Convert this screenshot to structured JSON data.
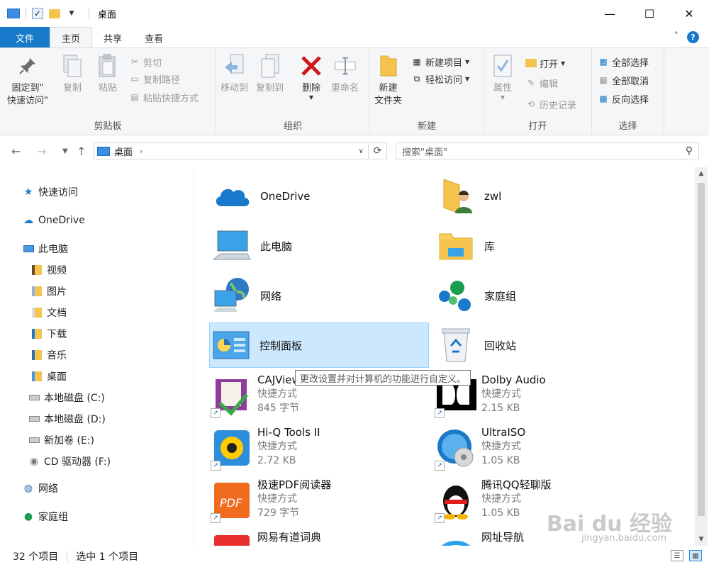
{
  "window": {
    "title": "桌面"
  },
  "ribbon_tabs": {
    "file": "文件",
    "home": "主页",
    "share": "共享",
    "view": "查看"
  },
  "ribbon": {
    "clipboard": {
      "label": "剪贴板",
      "pin_l1": "固定到\"",
      "pin_l2": "快速访问\"",
      "copy": "复制",
      "paste": "粘贴",
      "cut": "剪切",
      "copy_path": "复制路径",
      "paste_shortcut": "粘贴快捷方式"
    },
    "organize": {
      "label": "组织",
      "move_to": "移动到",
      "copy_to": "复制到",
      "delete": "删除",
      "rename": "重命名"
    },
    "new": {
      "label": "新建",
      "new_folder_l1": "新建",
      "new_folder_l2": "文件夹",
      "new_item": "新建项目",
      "easy_access": "轻松访问"
    },
    "open": {
      "label": "打开",
      "properties": "属性",
      "open": "打开",
      "edit": "编辑",
      "history": "历史记录"
    },
    "select": {
      "label": "选择",
      "select_all": "全部选择",
      "select_none": "全部取消",
      "invert": "反向选择"
    }
  },
  "address": {
    "path": "桌面",
    "search_placeholder": "搜索\"桌面\""
  },
  "sidebar": {
    "items": [
      {
        "label": "快速访问"
      },
      {
        "label": "OneDrive"
      },
      {
        "label": "此电脑"
      },
      {
        "label": "视频"
      },
      {
        "label": "图片"
      },
      {
        "label": "文档"
      },
      {
        "label": "下载"
      },
      {
        "label": "音乐"
      },
      {
        "label": "桌面"
      },
      {
        "label": "本地磁盘 (C:)"
      },
      {
        "label": "本地磁盘 (D:)"
      },
      {
        "label": "新加卷 (E:)"
      },
      {
        "label": "CD 驱动器 (F:)"
      },
      {
        "label": "网络"
      },
      {
        "label": "家庭组"
      }
    ]
  },
  "files": {
    "onedrive": "OneDrive",
    "zwl": "zwl",
    "this_pc": "此电脑",
    "library": "库",
    "network": "网络",
    "homegroup": "家庭组",
    "control_panel": "控制面板",
    "recycle_bin": "回收站",
    "cajviewer": {
      "name": "CAJViewer 7.2",
      "type": "快捷方式",
      "size": "845 字节"
    },
    "dolby": {
      "name": "Dolby Audio",
      "type": "快捷方式",
      "size": "2.15 KB"
    },
    "hiq": {
      "name": "Hi-Q Tools II",
      "type": "快捷方式",
      "size": "2.72 KB"
    },
    "ultraiso": {
      "name": "UltraISO",
      "type": "快捷方式",
      "size": "1.05 KB"
    },
    "pdf": {
      "name": "极速PDF阅读器",
      "type": "快捷方式",
      "size": "729 字节"
    },
    "qq": {
      "name": "腾讯QQ轻聊版",
      "type": "快捷方式",
      "size": "1.05 KB"
    },
    "youdao": {
      "name": "网易有道词典"
    },
    "webnav": {
      "name": "网址导航"
    }
  },
  "tooltip": "更改设置并对计算机的功能进行自定义。",
  "status": {
    "count": "32 个项目",
    "selected": "选中 1 个项目"
  },
  "watermark": {
    "main": "Bai du 经验",
    "sub": "jingyan.baidu.com"
  },
  "colors": {
    "accent": "#1979ca",
    "selection": "#cce8ff",
    "folder": "#f4c44e"
  }
}
